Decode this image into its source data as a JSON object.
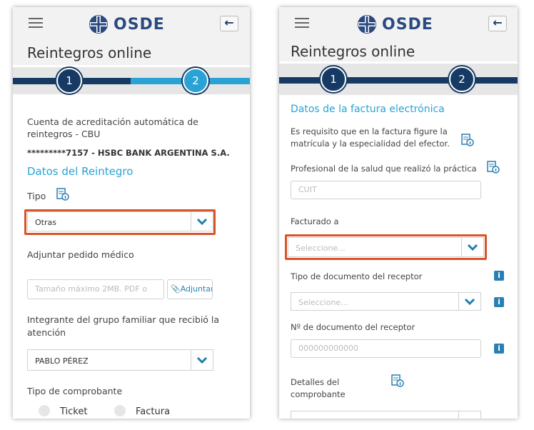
{
  "brand": {
    "logo_text": "OSDE"
  },
  "colors": {
    "accent": "#29a3d5",
    "navy": "#163a63",
    "highlight": "#d8552a",
    "step_light": "#29a3d5"
  },
  "left": {
    "title": "Reintegros online",
    "steps": [
      "1",
      "2"
    ],
    "cbu_label": "Cuenta de acreditación automática de reintegros - CBU",
    "cbu_value": "*********7157 - HSBC BANK ARGENTINA S.A.",
    "section_title": "Datos del Reintegro",
    "tipo_label": "Tipo",
    "tipo_value": "Otras",
    "adjuntar_label": "Adjuntar pedido médico",
    "adjuntar_placeholder": "Tamaño máximo 2MB. PDF o",
    "adjuntar_button": "Adjuntar",
    "integrante_label": "Integrante del grupo familiar que recibió la atención",
    "integrante_value": "PABLO PÉREZ",
    "comprobante_label": "Tipo de comprobante",
    "comprobante_options": [
      "Ticket",
      "Factura"
    ]
  },
  "right": {
    "title": "Reintegros online",
    "steps": [
      "1",
      "2"
    ],
    "section_title": "Datos de la factura electrónica",
    "requisito_text": "Es requisito que en la factura figure la matrícula y la especialidad del efector.",
    "profesional_label": "Profesional de la salud que realizó la práctica",
    "cuit_placeholder": "CUIT",
    "facturado_label": "Facturado a",
    "facturado_placeholder": "Seleccione...",
    "tipo_doc_label": "Tipo de documento del receptor",
    "tipo_doc_placeholder": "Seleccione...",
    "nro_doc_label": "Nº de documento del receptor",
    "nro_doc_placeholder": "000000000000",
    "detalles_label": "Detalles del comprobante",
    "info_glyph": "i"
  }
}
